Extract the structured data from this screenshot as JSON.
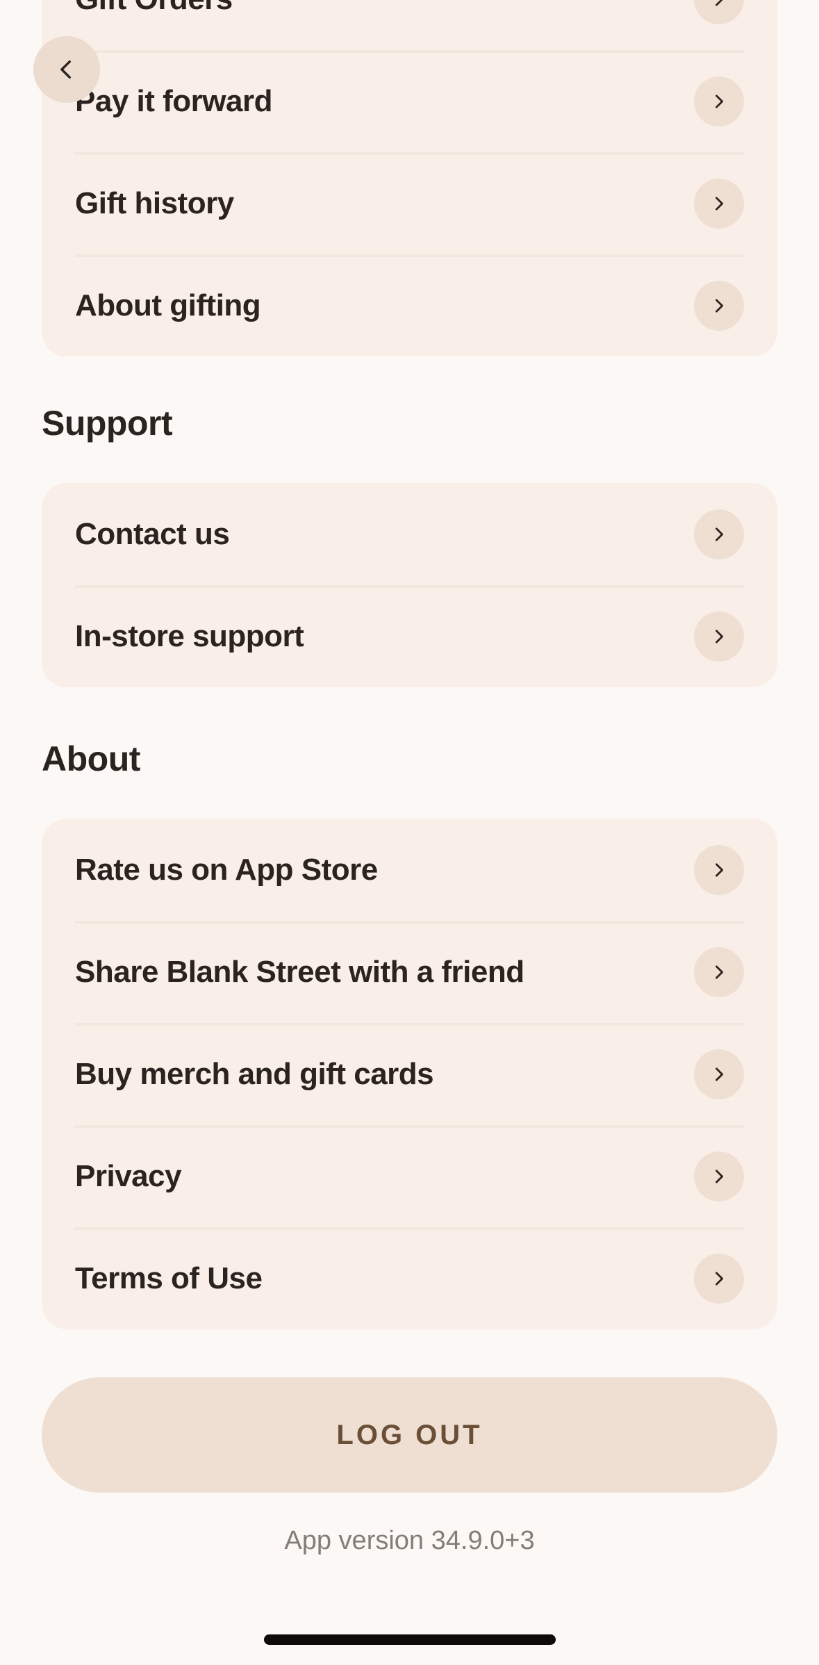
{
  "nav": {
    "back_icon": "chevron-left-icon"
  },
  "gifting": {
    "items": [
      {
        "label": "Gift Orders"
      },
      {
        "label": "Pay it forward"
      },
      {
        "label": "Gift history"
      },
      {
        "label": "About gifting"
      }
    ]
  },
  "support": {
    "title": "Support",
    "items": [
      {
        "label": "Contact us"
      },
      {
        "label": "In-store support"
      }
    ]
  },
  "about": {
    "title": "About",
    "items": [
      {
        "label": "Rate us on App Store"
      },
      {
        "label": "Share Blank Street with a friend"
      },
      {
        "label": "Buy merch and gift cards"
      },
      {
        "label": "Privacy"
      },
      {
        "label": "Terms of Use"
      }
    ]
  },
  "logout_label": "LOG OUT",
  "version_text": "App version 34.9.0+3",
  "colors": {
    "background": "#fcf8f5",
    "card": "#f9efe8",
    "chevron_bg": "#efdfd3",
    "logout_text": "#6a4e36"
  }
}
